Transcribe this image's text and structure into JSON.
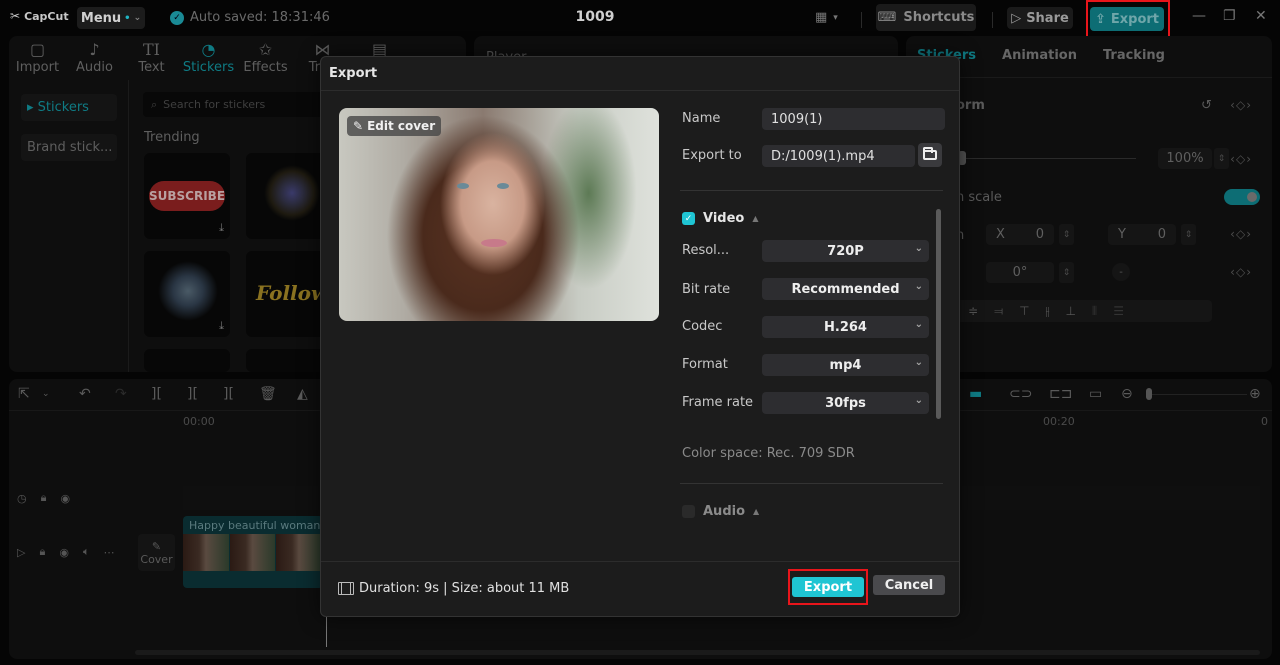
{
  "titlebar": {
    "app_name": "CapCut",
    "menu_label": "Menu",
    "autosave_text": "Auto saved: 18:31:46",
    "project_title": "1009",
    "shortcuts_label": "Shortcuts",
    "share_label": "Share",
    "export_label": "Export",
    "minimize_glyph": "—",
    "restore_glyph": "❐",
    "close_glyph": "✕"
  },
  "media_panel": {
    "tabs": [
      {
        "label": "Import",
        "icon": "▢"
      },
      {
        "label": "Audio",
        "icon": "♪"
      },
      {
        "label": "Text",
        "icon": "TI"
      },
      {
        "label": "Stickers",
        "icon": "◔"
      },
      {
        "label": "Effects",
        "icon": "✩"
      },
      {
        "label": "Tran",
        "icon": "⋈"
      },
      {
        "label": "",
        "icon": "▤"
      }
    ],
    "active_tab": "Stickers",
    "side_items": [
      {
        "label": "▸ Stickers"
      },
      {
        "label": "Brand stick..."
      }
    ],
    "search_placeholder": "Search for stickers",
    "section_title": "Trending",
    "stickers": [
      {
        "name": "subscribe",
        "label": "SUBSCRIBE"
      },
      {
        "name": "firework",
        "label": ""
      },
      {
        "name": "burst",
        "label": ""
      },
      {
        "name": "follow",
        "label": "Follow"
      }
    ],
    "download_glyph": "⤓"
  },
  "player": {
    "title": "Player"
  },
  "props_panel": {
    "tabs": [
      "Stickers",
      "Animation",
      "Tracking"
    ],
    "active_tab": "Stickers",
    "transform_label": "orm",
    "scale_value": "100%",
    "uniform_scale_label": "n scale",
    "position_label": "n",
    "x_label": "X",
    "x_value": "0",
    "y_label": "Y",
    "y_value": "0",
    "rotation_value": "0°",
    "keyframe_glyph": "‹◇›",
    "uniform_scale_on": true
  },
  "timeline": {
    "ruler_start": "00:00",
    "ruler_mid": "00:20",
    "ruler_end": "0",
    "clip_title": "Happy beautiful woman s",
    "cover_label": "Cover"
  },
  "dialog": {
    "title": "Export",
    "edit_cover_label": "Edit cover",
    "name_label": "Name",
    "name_value": "1009(1)",
    "export_to_label": "Export to",
    "export_to_value": "D:/1009(1).mp4",
    "video_section": {
      "label": "Video",
      "checked": true,
      "fields": [
        {
          "label": "Resol...",
          "value": "720P"
        },
        {
          "label": "Bit rate",
          "value": "Recommended"
        },
        {
          "label": "Codec",
          "value": "H.264"
        },
        {
          "label": "Format",
          "value": "mp4"
        },
        {
          "label": "Frame rate",
          "value": "30fps"
        }
      ]
    },
    "color_space": "Color space: Rec. 709 SDR",
    "audio_section": {
      "label": "Audio",
      "checked": false
    },
    "footer_info": "Duration: 9s | Size: about 11 MB",
    "export_button": "Export",
    "cancel_button": "Cancel"
  },
  "colors": {
    "accent": "#1fc5d3",
    "accent_dim": "#0d6d74",
    "highlight_box": "#e8151b",
    "dialog_bg": "#1c1c1c"
  }
}
